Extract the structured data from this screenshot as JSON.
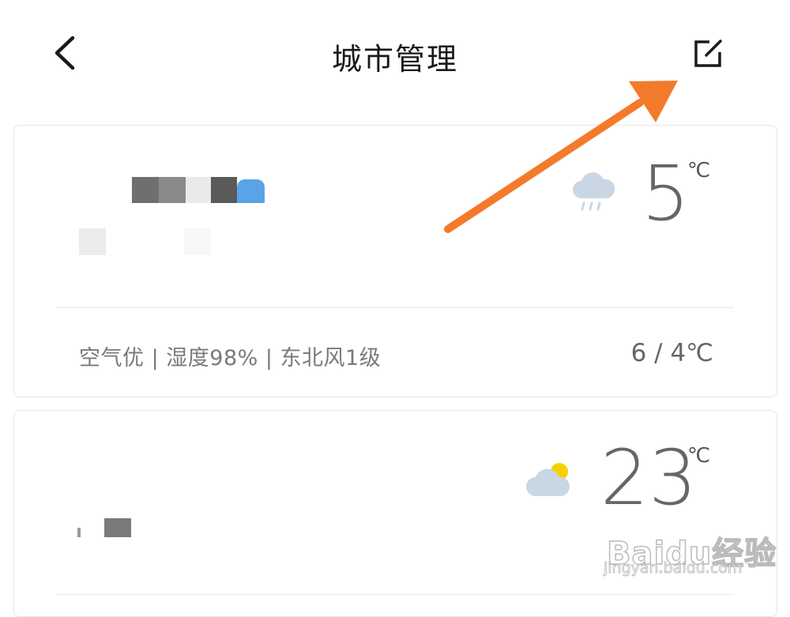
{
  "header": {
    "title": "城市管理"
  },
  "cities": [
    {
      "temperature": "5",
      "unit": "℃",
      "weather_icon": "cloud-rain-icon",
      "air_info": "空气优 | 湿度98% | 东北风1级",
      "temp_range": "6 / 4℃"
    },
    {
      "temperature": "23",
      "unit": "℃",
      "weather_icon": "partly-cloudy-icon"
    }
  ],
  "watermark": {
    "logo": "Baidu经验",
    "url": "jingyan.baidu.com"
  },
  "colors": {
    "arrow": "#F47A2B",
    "location_pin": "#5BA3E8",
    "sun": "#F7D000",
    "cloud": "#C9D6E4"
  }
}
